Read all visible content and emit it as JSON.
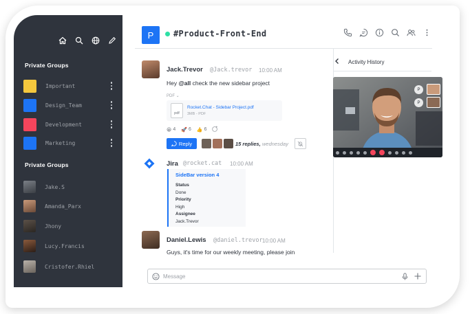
{
  "sidebar": {
    "icons": [
      "home-icon",
      "search-icon",
      "directory-icon",
      "edit-icon"
    ],
    "section_groups_title": "Private Groups",
    "groups": [
      {
        "label": "Important",
        "color": "#f5c83d"
      },
      {
        "label": "Design_Team",
        "color": "#1d74f5"
      },
      {
        "label": "Development",
        "color": "#f5455c"
      },
      {
        "label": "Marketing",
        "color": "#1d74f5"
      }
    ],
    "section_dms_title": "Private Groups",
    "dms": [
      {
        "label": "Jake.S"
      },
      {
        "label": "Amanda_Parx"
      },
      {
        "label": "Jhony"
      },
      {
        "label": "Lucy.Francis"
      },
      {
        "label": "Cristofer.Rhiel"
      }
    ]
  },
  "header": {
    "badge_letter": "P",
    "channel_name": "#Product-Front-End",
    "status_color": "#2de0a5",
    "icons": [
      "phone-icon",
      "threads-icon",
      "info-icon",
      "search-icon",
      "members-icon",
      "kebab-icon"
    ]
  },
  "messages": [
    {
      "author": "Jack.Trevor",
      "handle": "@Jack.trevor",
      "time": "10:00 AM",
      "text_prefix": "Hey ",
      "text_mention": "@all",
      "text_suffix": " check the new sidebar project",
      "attachment_header": "PDF",
      "attachment": {
        "icon_label": "pdf",
        "name": "Rocket.Chat - Sidebar Project.pdf",
        "meta": "3MB - PDF"
      },
      "reactions": [
        {
          "emoji": "😀",
          "count": "4"
        },
        {
          "emoji": "🚀",
          "count": "6"
        },
        {
          "emoji": "👍",
          "count": "6"
        }
      ],
      "reply_label": "Reply",
      "replies_count": "15 replies,",
      "replies_when": "wednesday"
    },
    {
      "author": "Jira",
      "handle": "@rocket.cat",
      "time": "10:00 AM",
      "card": {
        "title": "SideBar version 4",
        "status_label": "Status",
        "status_value": "Done",
        "priority_label": "Priority",
        "priority_value": "High",
        "assignee_label": "Assignee",
        "assignee_value": "Jack.Trevor"
      }
    },
    {
      "author": "Daniel.Lewis",
      "handle": "@daniel.trevor",
      "time": "10:00 AM",
      "text": "Guys, it's time for our weekly meeting, please join"
    }
  ],
  "activity": {
    "title": "Activity History",
    "video_tile_letters": [
      "P",
      "P"
    ]
  },
  "composer": {
    "placeholder": "Message"
  }
}
